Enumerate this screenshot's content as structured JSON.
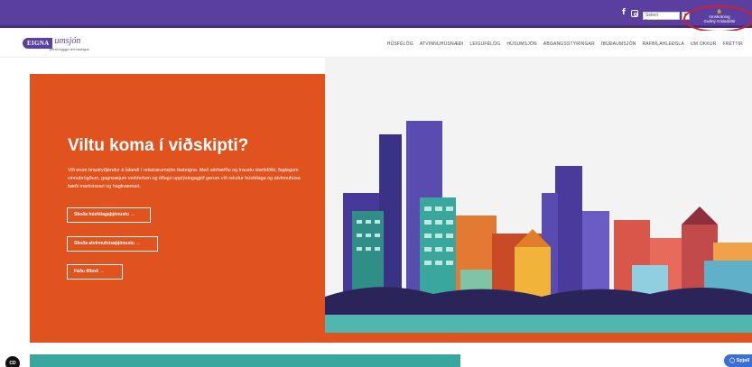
{
  "topbar": {
    "social_icons": [
      "facebook-icon",
      "instagram-icon"
    ],
    "facebook_glyph": "f",
    "language_select": "Select Language",
    "login_lock": "🔒",
    "login_line1": "Innskráning",
    "login_line2": "Guðný Gísladóttir"
  },
  "header": {
    "logo_brand": "EIGNA",
    "logo_script": "umsjón",
    "logo_tagline": "þitt að tryggja virði fasteigna",
    "nav": [
      "HÚSFÉLÖG",
      "ATVINNUHÚSNÆÐI",
      "LEIGUFÉLÖG",
      "HÚSUMSJÓN",
      "ABGANGSSTÝRINGAR",
      "ÍBÚÐAUMSJÓN",
      "RAFBÍLAHLEÐSLA",
      "UM OKKUR",
      "FRÉTTIR"
    ]
  },
  "hero": {
    "title": "Viltu koma í viðskipti?",
    "text": "Við erum brautryðjendur á Íslandi í rekstrarumsjón fasteigna. Með sérhæfðu og traustu starfsfólki, faglegum vinnubrögðum, gagnsæjum verkferlum og öflugri upplýsingagjöf gerum við rekstur húsfélaga og atvinnuhúsa bæði markvissari og hagkvæmari.",
    "button1": "Skoða húsfélagaþjónustu →",
    "button2": "Skoða atvinnuhúsaþjónustu →",
    "button3": "Fáðu tilboð →"
  },
  "bottom": {
    "cookie_label": "CD",
    "chat_label": "◯ Spjall"
  },
  "colors": {
    "topbar": "#5b3fa0",
    "hero_orange": "#e0531f",
    "teal": "#3aa79c",
    "chat_blue": "#3a6fd8",
    "highlight_red": "#d0202a"
  }
}
